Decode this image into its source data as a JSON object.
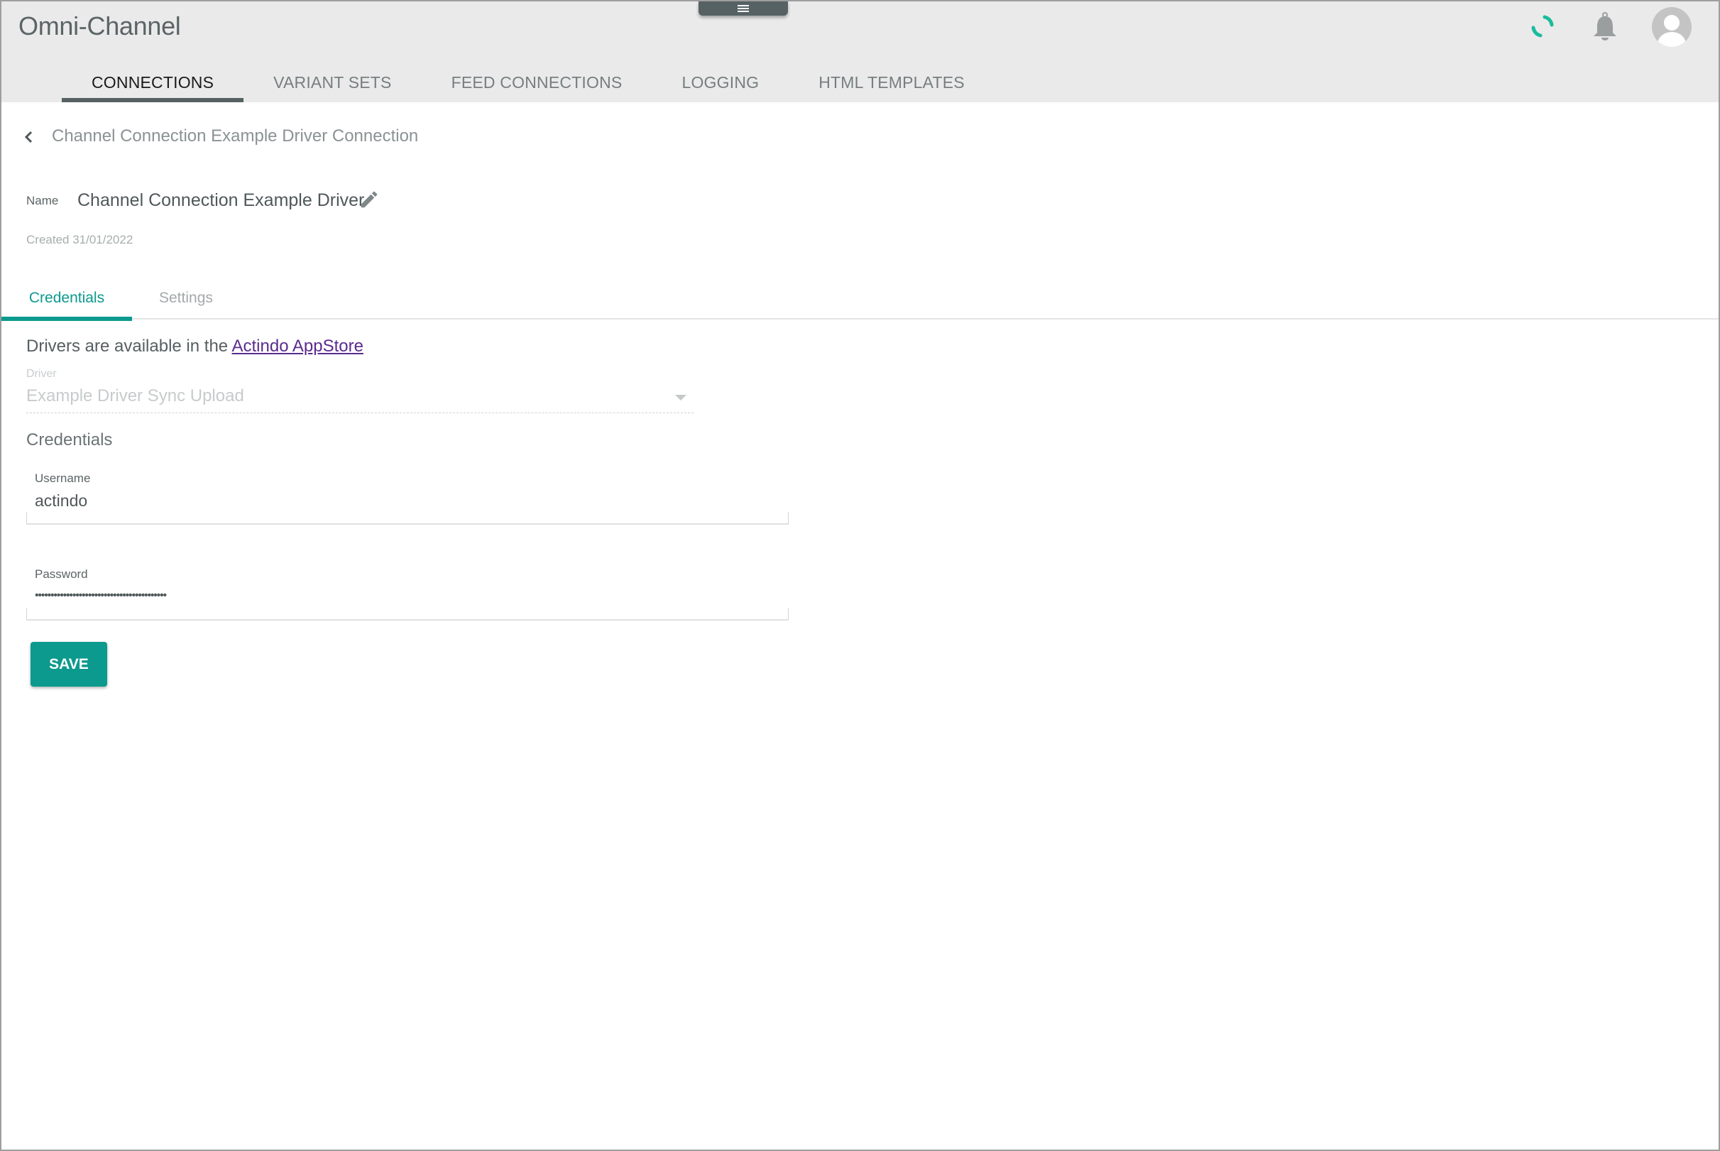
{
  "header": {
    "app_title": "Omni-Channel",
    "icons": {
      "menu": "menu-handle-icon",
      "loading": "loading-spinner-icon",
      "notifications": "bell-icon",
      "user": "user-avatar-icon"
    },
    "accent_color": "#0b9a8d"
  },
  "nav": {
    "tabs": [
      {
        "label": "CONNECTIONS",
        "active": true
      },
      {
        "label": "VARIANT SETS",
        "active": false
      },
      {
        "label": "FEED CONNECTIONS",
        "active": false
      },
      {
        "label": "LOGGING",
        "active": false
      },
      {
        "label": "HTML TEMPLATES",
        "active": false
      }
    ]
  },
  "detail": {
    "breadcrumb": "Channel Connection Example Driver Connection",
    "name_label": "Name",
    "name_value": "Channel Connection Example Driver",
    "created": "Created 31/01/2022"
  },
  "subtabs": [
    {
      "label": "Credentials",
      "active": true
    },
    {
      "label": "Settings",
      "active": false
    }
  ],
  "credentials": {
    "drivers_text": "Drivers are available in the ",
    "drivers_link": "Actindo AppStore",
    "driver_label": "Driver",
    "driver_value": "Example Driver Sync Upload",
    "heading": "Credentials",
    "username_label": "Username",
    "username_value": "actindo",
    "password_label": "Password",
    "password_value": "••••••••••••••••••••••••••••••••••••••••••",
    "save_label": "SAVE"
  }
}
